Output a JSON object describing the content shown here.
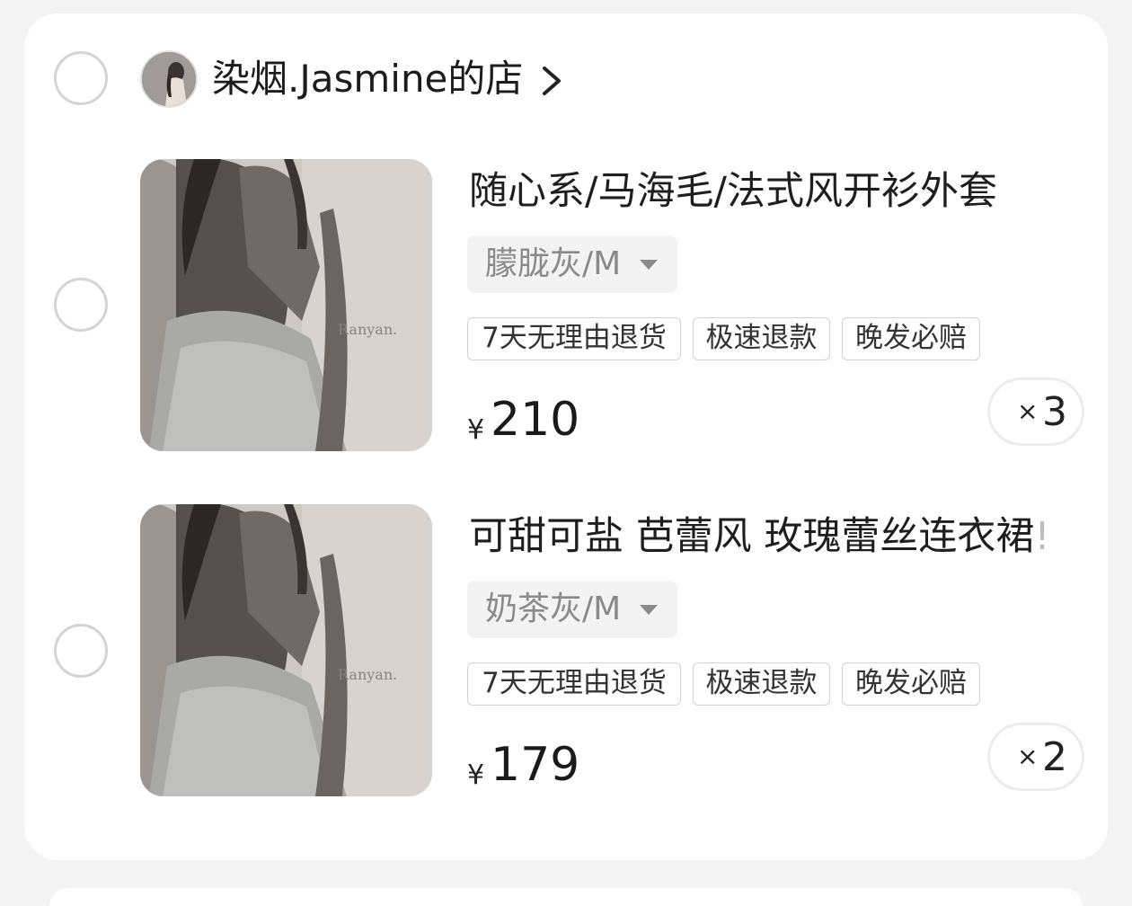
{
  "store": {
    "name": "染烟.Jasmine的店",
    "avatar_icon": "store-avatar",
    "avatar_text": "Ranyan\nJasmine",
    "chevron_icon": "chevron-right-icon"
  },
  "items": [
    {
      "title": "随心系/马海毛/法式风开衫外套",
      "title_overflow": "",
      "sku": "朦胧灰/M",
      "tags": [
        "7天无理由退货",
        "极速退款",
        "晚发必赔"
      ],
      "currency": "¥",
      "price": "210",
      "qty_prefix": "×",
      "qty": "3",
      "image_watermark": "Ranyan."
    },
    {
      "title": "可甜可盐 芭蕾风 玫瑰蕾丝连衣裙",
      "title_overflow": "!",
      "sku": "奶茶灰/M",
      "tags": [
        "7天无理由退货",
        "极速退款",
        "晚发必赔"
      ],
      "currency": "¥",
      "price": "179",
      "qty_prefix": "×",
      "qty": "2",
      "image_watermark": "Ranyan."
    }
  ],
  "colors": {
    "background": "#f4f4f4",
    "card": "#ffffff",
    "radio_border": "#d4d4d4",
    "sku_bg": "#f3f3f3",
    "tag_border": "#d2d2d2"
  }
}
